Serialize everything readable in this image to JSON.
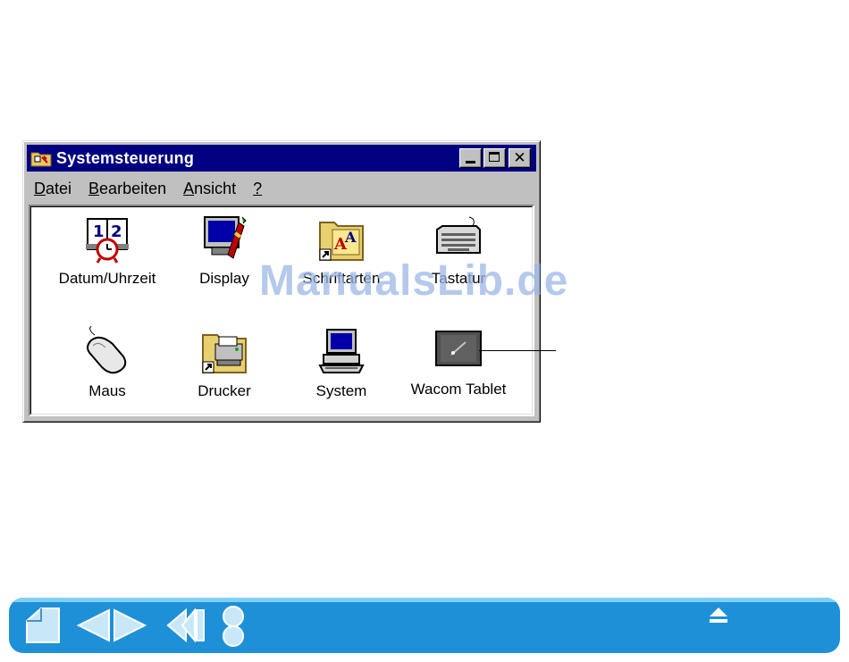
{
  "window": {
    "title": "Systemsteuerung",
    "controls": {
      "minimize": "minimize",
      "maximize": "maximize",
      "close": "✕"
    }
  },
  "menubar": [
    {
      "acc": "D",
      "rest": "atei"
    },
    {
      "acc": "B",
      "rest": "earbeiten"
    },
    {
      "acc": "A",
      "rest": "nsicht"
    },
    {
      "acc": "?",
      "rest": ""
    }
  ],
  "items": [
    {
      "label": "Datum/Uhrzeit",
      "icon": "calendar-clock-icon"
    },
    {
      "label": "Display",
      "icon": "display-icon"
    },
    {
      "label": "Schriftarten",
      "icon": "fonts-folder-icon"
    },
    {
      "label": "Tastatur",
      "icon": "keyboard-icon"
    },
    {
      "label": "Maus",
      "icon": "mouse-icon"
    },
    {
      "label": "Drucker",
      "icon": "printer-folder-icon"
    },
    {
      "label": "System",
      "icon": "computer-icon"
    },
    {
      "label": "Wacom Tablet",
      "icon": "tablet-icon"
    }
  ],
  "watermark": "ManualsLib.de",
  "nav": {
    "buttons": [
      "home-icon",
      "prev-page-icon",
      "next-page-icon",
      "back-icon",
      "index-icon",
      "eject-icon"
    ]
  },
  "colors": {
    "titlebar": "#000080",
    "window": "#c0c0c0",
    "navbar": "#1e90d8"
  }
}
